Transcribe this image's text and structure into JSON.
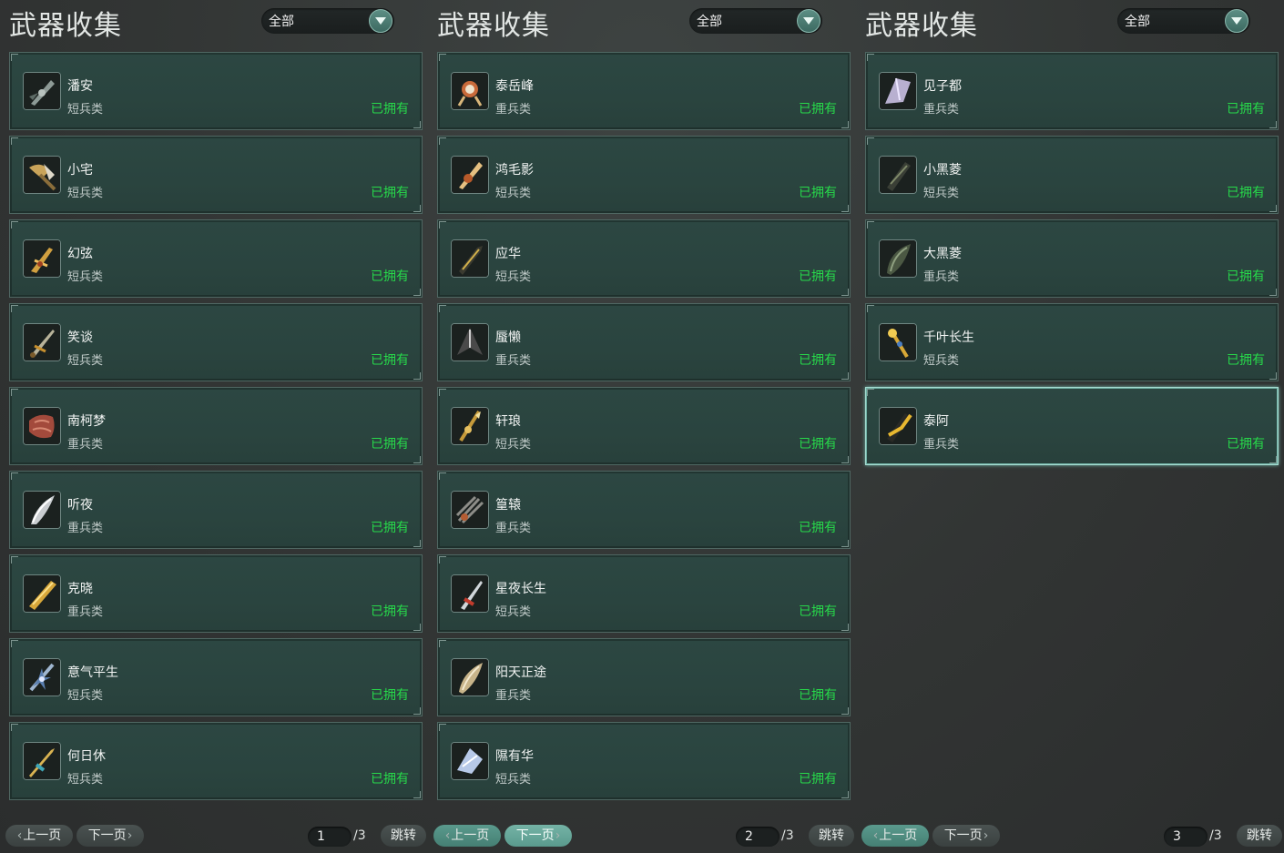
{
  "panels": [
    {
      "title": "武器收集",
      "filter": "全部",
      "items": [
        {
          "name": "潘安",
          "type": "短兵类",
          "status": "已拥有",
          "icon": "blade-icon"
        },
        {
          "name": "小宅",
          "type": "短兵类",
          "status": "已拥有",
          "icon": "axe-icon"
        },
        {
          "name": "幻弦",
          "type": "短兵类",
          "status": "已拥有",
          "icon": "golden-blade-icon"
        },
        {
          "name": "笑谈",
          "type": "短兵类",
          "status": "已拥有",
          "icon": "sword-icon"
        },
        {
          "name": "南柯梦",
          "type": "重兵类",
          "status": "已拥有",
          "icon": "meat-blade-icon"
        },
        {
          "name": "听夜",
          "type": "重兵类",
          "status": "已拥有",
          "icon": "silver-blade-icon"
        },
        {
          "name": "克晓",
          "type": "重兵类",
          "status": "已拥有",
          "icon": "gold-greatsword-icon"
        },
        {
          "name": "意气平生",
          "type": "短兵类",
          "status": "已拥有",
          "icon": "spiked-sword-icon"
        },
        {
          "name": "何日休",
          "type": "短兵类",
          "status": "已拥有",
          "icon": "dagger-icon"
        }
      ],
      "pager": {
        "prev": "上一页",
        "next": "下一页",
        "page": "1",
        "total": "/3",
        "jump": "跳转"
      }
    },
    {
      "title": "武器收集",
      "filter": "全部",
      "items": [
        {
          "name": "泰岳峰",
          "type": "重兵类",
          "status": "已拥有",
          "icon": "ornate-blade-icon"
        },
        {
          "name": "鸿毛影",
          "type": "短兵类",
          "status": "已拥有",
          "icon": "feather-sword-icon"
        },
        {
          "name": "应华",
          "type": "短兵类",
          "status": "已拥有",
          "icon": "dark-sword-icon"
        },
        {
          "name": "蜃懒",
          "type": "重兵类",
          "status": "已拥有",
          "icon": "dark-greatblade-icon"
        },
        {
          "name": "轩琅",
          "type": "短兵类",
          "status": "已拥有",
          "icon": "golden-spear-icon"
        },
        {
          "name": "篁辕",
          "type": "重兵类",
          "status": "已拥有",
          "icon": "claw-blade-icon"
        },
        {
          "name": "星夜长生",
          "type": "短兵类",
          "status": "已拥有",
          "icon": "star-dagger-icon"
        },
        {
          "name": "阳天正途",
          "type": "重兵类",
          "status": "已拥有",
          "icon": "bronze-blade-icon"
        },
        {
          "name": "隰有华",
          "type": "短兵类",
          "status": "已拥有",
          "icon": "crystal-blade-icon"
        }
      ],
      "pager": {
        "prev": "上一页",
        "next": "下一页",
        "page": "2",
        "total": "/3",
        "jump": "跳转"
      }
    },
    {
      "title": "武器收集",
      "filter": "全部",
      "items": [
        {
          "name": "见子都",
          "type": "重兵类",
          "status": "已拥有",
          "icon": "crystal-shard-icon"
        },
        {
          "name": "小黑菱",
          "type": "短兵类",
          "status": "已拥有",
          "icon": "black-dagger-icon"
        },
        {
          "name": "大黑菱",
          "type": "重兵类",
          "status": "已拥有",
          "icon": "black-greatblade-icon"
        },
        {
          "name": "千叶长生",
          "type": "短兵类",
          "status": "已拥有",
          "icon": "golden-scepter-icon"
        },
        {
          "name": "泰阿",
          "type": "重兵类",
          "status": "已拥有",
          "icon": "dark-gold-blade-icon"
        }
      ],
      "pager": {
        "prev": "上一页",
        "next": "下一页",
        "page": "3",
        "total": "/3",
        "jump": "跳转"
      }
    }
  ],
  "colors": {
    "owned": "#27d94a",
    "card_bg": "#2b4540",
    "selected_border": "#a6dcd1"
  }
}
